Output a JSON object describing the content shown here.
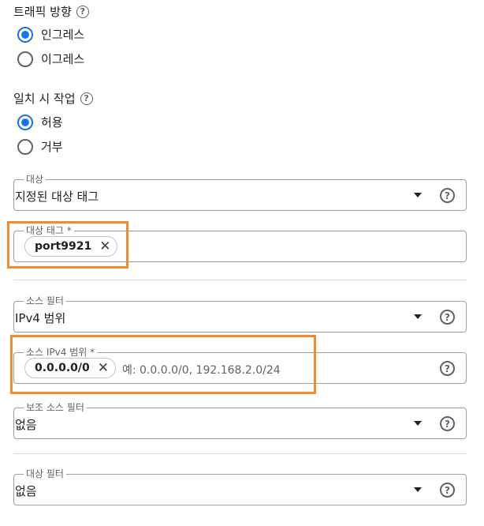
{
  "traffic_direction": {
    "title": "트래픽 방향",
    "options": [
      {
        "label": "인그레스",
        "checked": true
      },
      {
        "label": "이그레스",
        "checked": false
      }
    ]
  },
  "match_action": {
    "title": "일치 시 작업",
    "options": [
      {
        "label": "허용",
        "checked": true
      },
      {
        "label": "거부",
        "checked": false
      }
    ]
  },
  "target": {
    "label": "대상",
    "value": "지정된 대상 태그"
  },
  "target_tags": {
    "label": "대상 태그 *",
    "chip": "port9921"
  },
  "source_filter": {
    "label": "소스 필터",
    "value": "IPv4 범위"
  },
  "source_ipv4": {
    "label": "소스 IPv4 범위 *",
    "chip": "0.0.0.0/0",
    "placeholder": "예: 0.0.0.0/0, 192.168.2.0/24"
  },
  "secondary_source_filter": {
    "label": "보조 소스 필터",
    "value": "없음"
  },
  "destination_filter": {
    "label": "대상 필터",
    "value": "없음"
  },
  "icons": {
    "help": "?",
    "close": "✕"
  },
  "colors": {
    "accent": "#1a73e8",
    "highlight": "#f28b2c"
  }
}
